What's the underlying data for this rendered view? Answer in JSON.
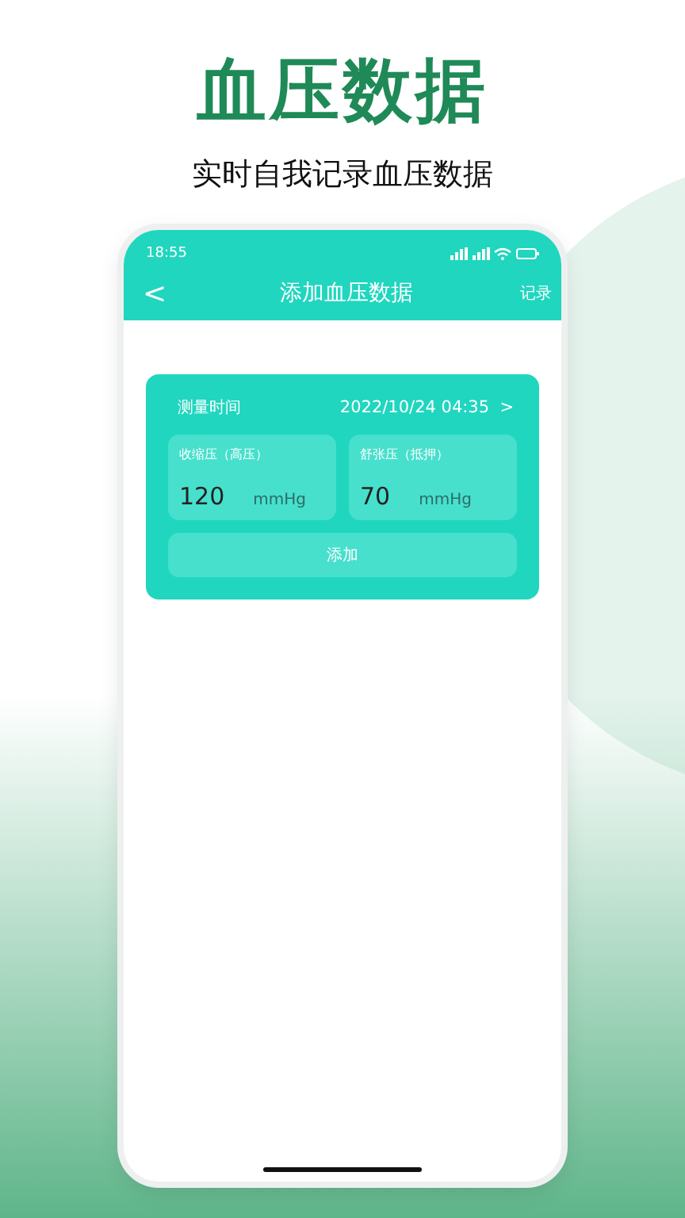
{
  "headline": "血压数据",
  "subtitle": "实时自我记录血压数据",
  "status_bar": {
    "time": "18:55"
  },
  "nav": {
    "back": "<",
    "title": "添加血压数据",
    "action": "记录"
  },
  "form": {
    "time_label": "测量时间",
    "time_value": "2022/10/24 04:35",
    "time_chevron": ">",
    "fields": [
      {
        "label": "收缩压（高压）",
        "value": "120",
        "unit": "mmHg"
      },
      {
        "label": "舒张压（抵押）",
        "value": "70",
        "unit": "mmHg"
      }
    ],
    "button": "添加"
  }
}
